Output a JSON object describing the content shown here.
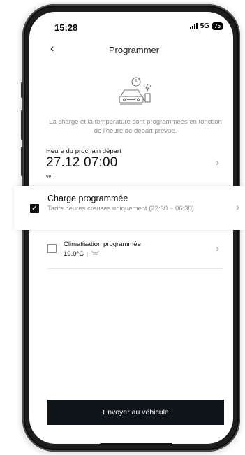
{
  "status_bar": {
    "time": "15:28",
    "network": "5G",
    "battery": "75"
  },
  "header": {
    "back_icon": "chevron-left-icon",
    "title": "Programmer"
  },
  "illustration": {
    "icon": "car-charging-alarm-icon"
  },
  "description": "La charge et la température sont programmées en fonction de l'heure de départ prévue.",
  "departure": {
    "label": "Heure du prochain départ",
    "value": "27.12 07:00",
    "day": "ve."
  },
  "charge": {
    "checked": true,
    "title": "Charge programmée",
    "subtitle": "Tarifs heures creuses uniquement (22:30 ~ 06:30)"
  },
  "climate": {
    "checked": false,
    "title": "Climatisation programmée",
    "temperature": "19.0°C",
    "seat_icon": "seat-heating-icon"
  },
  "send_button": {
    "label": "Envoyer au véhicule"
  },
  "colors": {
    "button_bg": "#0f1419",
    "frame": "#1d1d1f",
    "muted_text": "#8c8c8c"
  }
}
